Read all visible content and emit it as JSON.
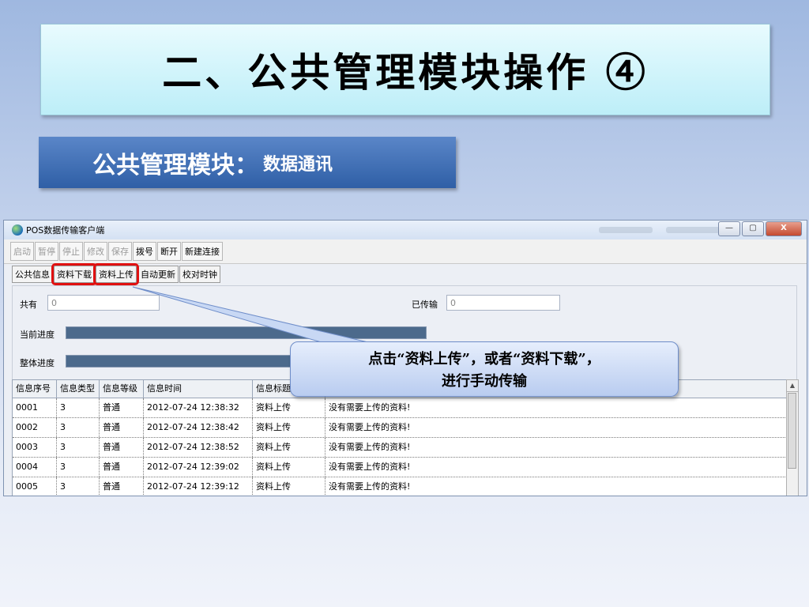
{
  "slide": {
    "title": "二、公共管理模块操作 ④",
    "subtitle_main": "公共管理模块：",
    "subtitle_small": "数据通讯",
    "callout_line1": "点击“资料上传”，或者“资料下载”，",
    "callout_line2": "进行手动传输"
  },
  "window": {
    "title": "POS数据传输客户端",
    "controls": {
      "minimize": "—",
      "maximize": "▢",
      "close": "X"
    }
  },
  "toolbar": [
    "启动",
    "暂停",
    "停止",
    "修改",
    "保存",
    "拨号",
    "断开",
    "新建连接"
  ],
  "tabs": [
    "公共信息",
    "资料下载",
    "资料上传",
    "自动更新",
    "校对时钟"
  ],
  "form": {
    "total_label": "共有",
    "total_value": "0",
    "sent_label": "已传输",
    "sent_value": "0",
    "current_label": "当前进度",
    "overall_label": "整体进度"
  },
  "grid": {
    "headers": [
      "信息序号",
      "信息类型",
      "信息等级",
      "信息时间",
      "信息标题",
      ""
    ],
    "rows": [
      [
        "0001",
        "3",
        "普通",
        "2012-07-24 12:38:32",
        "资料上传",
        "没有需要上传的资料!"
      ],
      [
        "0002",
        "3",
        "普通",
        "2012-07-24 12:38:42",
        "资料上传",
        "没有需要上传的资料!"
      ],
      [
        "0003",
        "3",
        "普通",
        "2012-07-24 12:38:52",
        "资料上传",
        "没有需要上传的资料!"
      ],
      [
        "0004",
        "3",
        "普通",
        "2012-07-24 12:39:02",
        "资料上传",
        "没有需要上传的资料!"
      ],
      [
        "0005",
        "3",
        "普通",
        "2012-07-24 12:39:12",
        "资料上传",
        "没有需要上传的资料!"
      ]
    ]
  },
  "colors": {
    "highlight": "#e01010",
    "callout_border": "#6e8dc9",
    "title_bg": "#bdeef8",
    "subtitle_bg": "#2f5fa6"
  },
  "icons": [
    "globe-icon",
    "minimize-icon",
    "maximize-icon",
    "close-icon",
    "scroll-up-icon"
  ]
}
